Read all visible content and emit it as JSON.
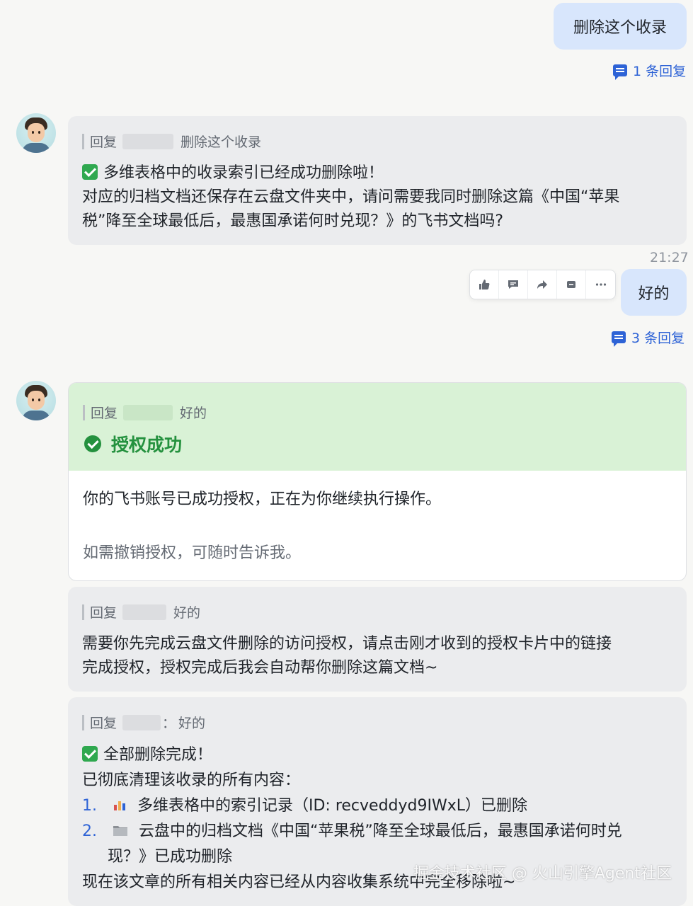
{
  "msg1": {
    "text": "删除这个收录",
    "reply_count": "1 条回复"
  },
  "bot1": {
    "quote_prefix": "回复",
    "quote_text": "删除这个收录",
    "line1": "多维表格中的收录索引已经成功删除啦！",
    "line2": "对应的归档文档还保存在云盘文件夹中，请问需要我同时删除这篇《中国“苹果",
    "line3": "税”降至全球最低后，最惠国承诺何时兑现？》的飞书文档吗?"
  },
  "time": "21:27",
  "toolbar": [
    "thumb-up-icon",
    "comment-icon",
    "forward-icon",
    "pin-icon",
    "more-icon"
  ],
  "msg2": {
    "text": "好的",
    "reply_count": "3 条回复"
  },
  "auth": {
    "quote_prefix": "回复",
    "quote_text": "好的",
    "title": "授权成功",
    "body1": "你的飞书账号已成功授权，正在为你继续执行操作。",
    "body2": "如需撤销授权，可随时告诉我。"
  },
  "bot2": {
    "quote_prefix": "回复",
    "quote_text": "好的",
    "line1": "需要你先完成云盘文件删除的访问授权，请点击刚才收到的授权卡片中的链接",
    "line2": "完成授权，授权完成后我会自动帮你删除这篇文档~"
  },
  "bot3": {
    "quote_prefix": "回复",
    "quote_sep": "：",
    "quote_text": "好的",
    "line1": "全部删除完成！",
    "line2": "已彻底清理该收录的所有内容：",
    "item1_num": "1.",
    "item1": "多维表格中的索引记录（ID: recveddyd9IWxL）已删除",
    "item2_num": "2.",
    "item2a": "云盘中的归档文档《中国“苹果税”降至全球最低后，最惠国承诺何时兑",
    "item2b": "现？》已成功删除",
    "line3": "现在该文章的所有相关内容已经从内容收集系统中完全移除啦~"
  },
  "watermark": "掘金技术社区 @ 火山引擎Agent社区",
  "colors": {
    "accent": "#2e63d6",
    "outgoing_bubble": "#d8e6fc",
    "success_green": "#24913e",
    "success_bg": "#d9f2d6"
  }
}
